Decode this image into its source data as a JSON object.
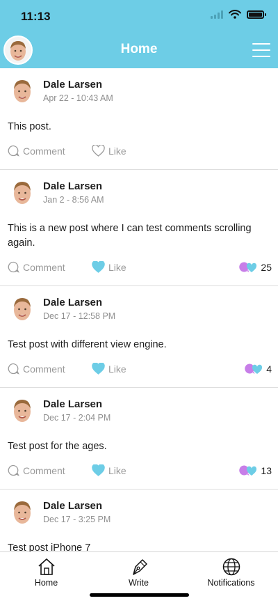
{
  "status_bar": {
    "time": "11:13",
    "icons": [
      "signal-icon",
      "wifi-icon",
      "battery-icon"
    ]
  },
  "header": {
    "title": "Home",
    "avatar_icon": "user-avatar",
    "menu_icon": "hamburger-menu-icon"
  },
  "colors": {
    "accent": "#6dcde6",
    "like_heart": "#6dcde6",
    "reaction_purple": "#c77ee8",
    "muted_text": "#9a9a9a"
  },
  "posts": [
    {
      "author": "Dale Larsen",
      "date": "Apr 22 - 10:43 AM",
      "text": "This post.",
      "comment_label": "Comment",
      "like_label": "Like",
      "liked": false,
      "like_count": ""
    },
    {
      "author": "Dale Larsen",
      "date": "Jan 2 - 8:56 AM",
      "text": "This is a new post where I can test comments scrolling again.",
      "comment_label": "Comment",
      "like_label": "Like",
      "liked": true,
      "like_count": "25"
    },
    {
      "author": "Dale Larsen",
      "date": "Dec 17 - 12:58 PM",
      "text": "Test post with different view engine.",
      "comment_label": "Comment",
      "like_label": "Like",
      "liked": true,
      "like_count": "4"
    },
    {
      "author": "Dale Larsen",
      "date": "Dec 17 - 2:04 PM",
      "text": "Test post for the ages.",
      "comment_label": "Comment",
      "like_label": "Like",
      "liked": true,
      "like_count": "13"
    },
    {
      "author": "Dale Larsen",
      "date": "Dec 17 - 3:25 PM",
      "text": "Test post iPhone 7",
      "comment_label": "Comment",
      "like_label": "Like",
      "liked": false,
      "like_count": ""
    }
  ],
  "tabbar": {
    "items": [
      {
        "label": "Home",
        "icon": "home-icon"
      },
      {
        "label": "Write",
        "icon": "pen-nib-icon"
      },
      {
        "label": "Notifications",
        "icon": "globe-icon"
      }
    ]
  }
}
